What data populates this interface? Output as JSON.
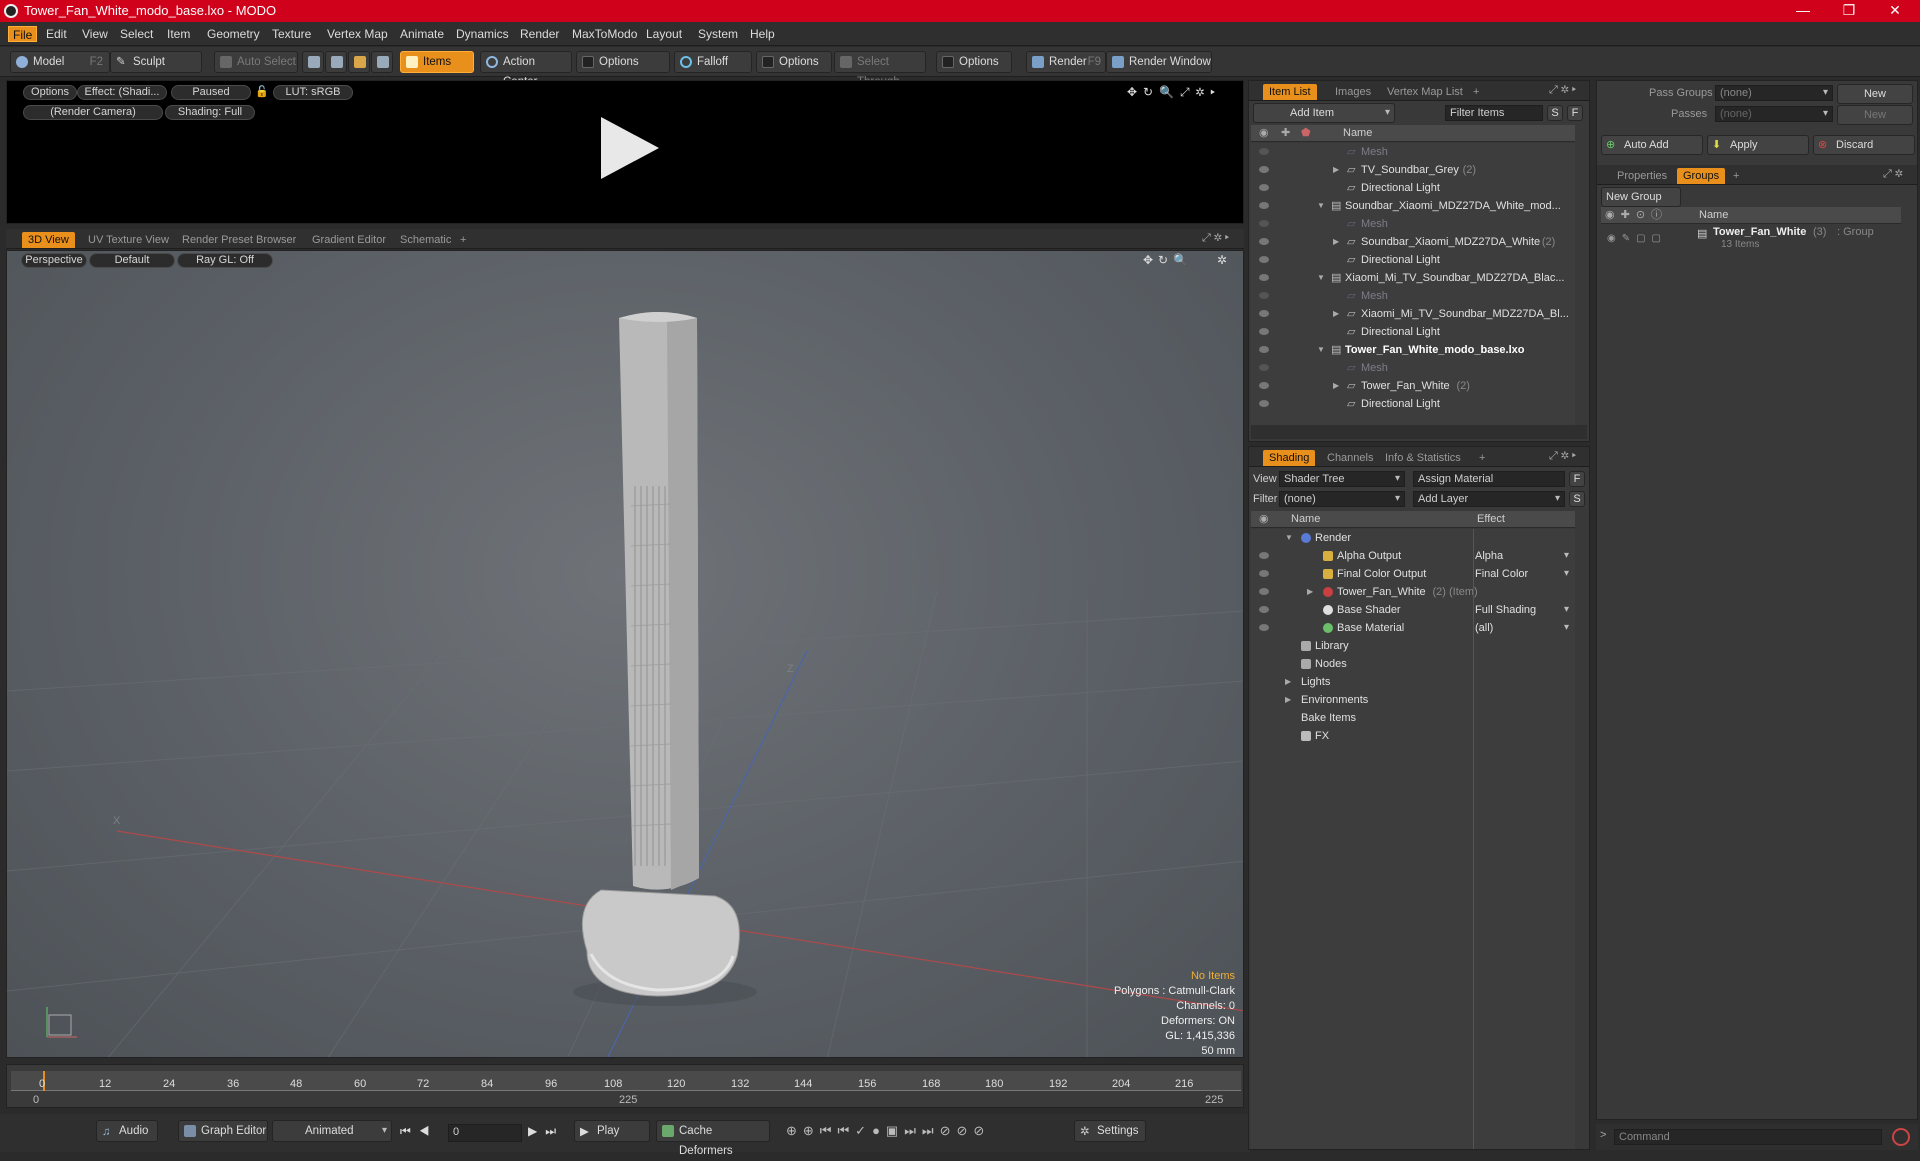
{
  "window": {
    "title": "Tower_Fan_White_modo_base.lxo - MODO",
    "min": "—",
    "max": "❐",
    "close": "✕"
  },
  "menu": [
    "File",
    "Edit",
    "View",
    "Select",
    "Item",
    "Geometry",
    "Texture",
    "Vertex Map",
    "Animate",
    "Dynamics",
    "Render",
    "MaxToModo",
    "Layout",
    "System",
    "Help"
  ],
  "toolbar": {
    "model": "Model",
    "model_key": "F2",
    "sculpt": "Sculpt",
    "auto_select": "Auto Select",
    "items": "Items",
    "action_center": "Action Center",
    "options1": "Options",
    "falloff": "Falloff",
    "options2": "Options",
    "select_through": "Select Through",
    "options3": "Options",
    "render": "Render",
    "render_key": "F9",
    "render_window": "Render Window"
  },
  "preview": {
    "options": "Options",
    "effect": "Effect: (Shadi...",
    "paused": "Paused",
    "lut": "LUT: sRGB",
    "camera": "(Render Camera)",
    "shading": "Shading: Full"
  },
  "viewport_tabs": [
    "3D View",
    "UV Texture View",
    "Render Preset Browser",
    "Gradient Editor",
    "Schematic",
    "+"
  ],
  "viewport": {
    "perspective": "Perspective",
    "default": "Default",
    "raygl": "Ray GL: Off",
    "axis_z": "Z",
    "axis_x": "X",
    "stats": {
      "no_items": "No Items",
      "polygons": "Polygons : Catmull-Clark",
      "channels": "Channels: 0",
      "deformers": "Deformers: ON",
      "gl": "GL: 1,415,336",
      "unit": "50 mm"
    }
  },
  "timeline": {
    "ticks": [
      "0",
      "12",
      "24",
      "36",
      "48",
      "60",
      "72",
      "84",
      "96",
      "108",
      "120",
      "132",
      "144",
      "156",
      "168",
      "180",
      "192",
      "204",
      "216"
    ],
    "start": "0",
    "mid": "225",
    "end": "225"
  },
  "bottombar": {
    "audio": "Audio",
    "graph_editor": "Graph Editor",
    "animated": "Animated",
    "frame": "0",
    "play": "Play",
    "cache": "Cache Deformers",
    "settings": "Settings"
  },
  "itemlist": {
    "tabs": [
      "Item List",
      "Images",
      "Vertex Map List",
      "+"
    ],
    "add_item": "Add Item",
    "filter": "Filter Items",
    "s": "S",
    "f": "F",
    "col_name": "Name",
    "rows": [
      {
        "label": "Mesh",
        "indent": 1,
        "dim": true,
        "arrow": ""
      },
      {
        "label": "TV_Soundbar_Grey",
        "count": "(2)",
        "indent": 1,
        "arrow": "▶"
      },
      {
        "label": "Directional Light",
        "indent": 1,
        "arrow": ""
      },
      {
        "label": "Soundbar_Xiaomi_MDZ27DA_White_mod...",
        "indent": 0,
        "arrow": "▼"
      },
      {
        "label": "Mesh",
        "indent": 1,
        "dim": true,
        "arrow": ""
      },
      {
        "label": "Soundbar_Xiaomi_MDZ27DA_White",
        "count": "(2)",
        "indent": 1,
        "arrow": "▶"
      },
      {
        "label": "Directional Light",
        "indent": 1,
        "arrow": ""
      },
      {
        "label": "Xiaomi_Mi_TV_Soundbar_MDZ27DA_Blac...",
        "indent": 0,
        "arrow": "▼"
      },
      {
        "label": "Mesh",
        "indent": 1,
        "dim": true,
        "arrow": ""
      },
      {
        "label": "Xiaomi_Mi_TV_Soundbar_MDZ27DA_Bl...",
        "indent": 1,
        "arrow": "▶"
      },
      {
        "label": "Directional Light",
        "indent": 1,
        "arrow": ""
      },
      {
        "label": "Tower_Fan_White_modo_base.lxo",
        "indent": 0,
        "arrow": "▼",
        "bold": true
      },
      {
        "label": "Mesh",
        "indent": 1,
        "dim": true,
        "arrow": ""
      },
      {
        "label": "Tower_Fan_White",
        "count": "(2)",
        "indent": 1,
        "arrow": "▶"
      },
      {
        "label": "Directional Light",
        "indent": 1,
        "arrow": ""
      }
    ]
  },
  "shading": {
    "tabs": [
      "Shading",
      "Channels",
      "Info & Statistics",
      "+"
    ],
    "view_label": "View",
    "view_value": "Shader Tree",
    "assign": "Assign Material",
    "filter_label": "Filter",
    "filter_value": "(none)",
    "add_layer": "Add Layer",
    "f": "F",
    "s": "S",
    "col_name": "Name",
    "col_effect": "Effect",
    "rows": [
      {
        "label": "Render",
        "effect": "",
        "indent": 0,
        "arrow": "▼",
        "icon": "sphere-icon"
      },
      {
        "label": "Alpha Output",
        "effect": "Alpha",
        "indent": 1,
        "icon": "output-icon"
      },
      {
        "label": "Final Color Output",
        "effect": "Final Color",
        "indent": 1,
        "icon": "output-icon"
      },
      {
        "label": "Tower_Fan_White",
        "extra": "(2) (Item)",
        "effect": "",
        "indent": 1,
        "arrow": "▶",
        "icon": "material-group-icon"
      },
      {
        "label": "Base Shader",
        "effect": "Full Shading",
        "indent": 1,
        "icon": "shader-icon"
      },
      {
        "label": "Base Material",
        "effect": "(all)",
        "indent": 1,
        "icon": "material-icon"
      },
      {
        "label": "Library",
        "effect": "",
        "indent": 0,
        "icon": "folder-icon"
      },
      {
        "label": "Nodes",
        "effect": "",
        "indent": 0,
        "icon": "folder-icon"
      },
      {
        "label": "Lights",
        "effect": "",
        "indent": 0,
        "arrow": "▶",
        "icon": ""
      },
      {
        "label": "Environments",
        "effect": "",
        "indent": 0,
        "arrow": "▶",
        "icon": ""
      },
      {
        "label": "Bake Items",
        "effect": "",
        "indent": 0,
        "icon": ""
      },
      {
        "label": "FX",
        "effect": "",
        "indent": 0,
        "icon": "fx-icon"
      }
    ]
  },
  "right": {
    "pass_groups": "Pass Groups",
    "passes": "Passes",
    "none1": "(none)",
    "none2": "(none)",
    "new1": "New",
    "new2": "New",
    "auto_add": "Auto Add",
    "apply": "Apply",
    "discard": "Discard",
    "tabs": [
      "Properties",
      "Groups",
      "+"
    ],
    "new_group": "New Group",
    "col_name": "Name",
    "group_name": "Tower_Fan_White",
    "group_count": "(3)",
    "group_type": ": Group",
    "group_items": "13 Items"
  },
  "command": {
    "placeholder": "Command"
  }
}
